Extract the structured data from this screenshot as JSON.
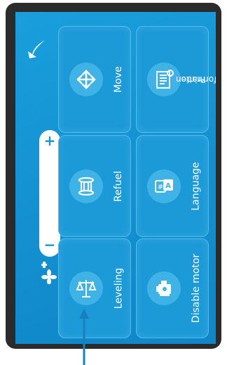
{
  "menu": {
    "items": [
      {
        "label": "Move",
        "icon": "move-arrows-icon"
      },
      {
        "label": "Printer information",
        "icon": "printer-info-icon"
      },
      {
        "label": "Refuel",
        "icon": "filament-spool-icon"
      },
      {
        "label": "Language",
        "icon": "language-icon"
      },
      {
        "label": "Leveling",
        "icon": "balance-scale-icon"
      },
      {
        "label": "Disable motor",
        "icon": "motor-icon"
      }
    ]
  },
  "printer_info": {
    "line1": "Printer",
    "line2": "information"
  },
  "fan": {
    "plus": "+",
    "minus": "−",
    "level": 0.5
  },
  "colors": {
    "screen": "#1592d2",
    "tile": "#1c9ad8",
    "circle": "#40b3e6",
    "bezel": "#2b2b2b",
    "pointer": "#1a7fc0"
  }
}
